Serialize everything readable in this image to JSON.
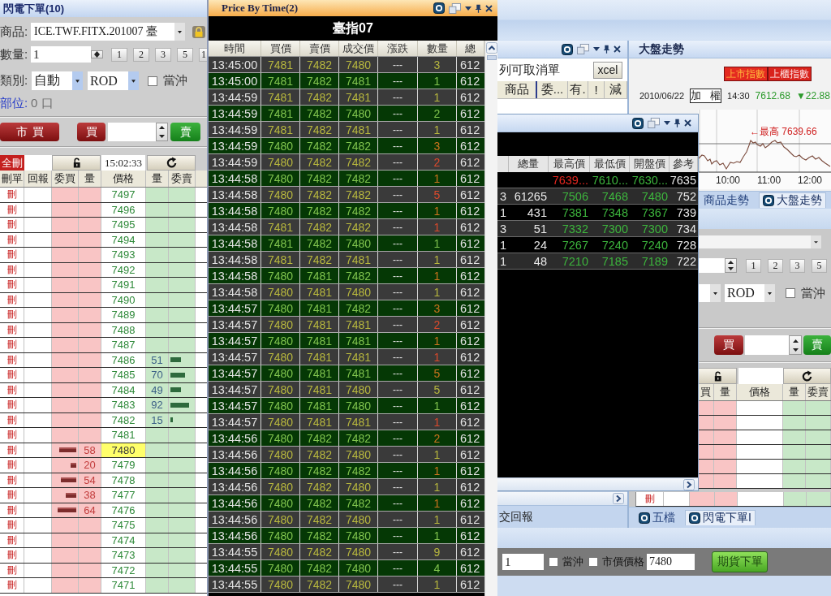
{
  "flash_order": {
    "title": "閃電下單(10)",
    "product": {
      "label": "商品:",
      "value": "ICE.TWF.FITX.201007 臺"
    },
    "quantity": {
      "label": "數量:",
      "value": "1",
      "presets": [
        "1",
        "2",
        "3",
        "5",
        "1"
      ]
    },
    "category": {
      "label": "類別:",
      "type": "自動",
      "condition": "ROD",
      "day_trade": {
        "label": "當沖",
        "checked": false
      }
    },
    "position": {
      "label": "部位:",
      "value": "0 口"
    },
    "actions": {
      "market_buy": "市買",
      "buy": "買",
      "sell": "賣"
    },
    "toolbar": {
      "delete_all": "全刪",
      "time": "15:02:33"
    },
    "ladder": {
      "columns": [
        "刪單",
        "回報",
        "委買",
        "量",
        "價格",
        "量",
        "委賣"
      ],
      "rows": [
        {
          "delete": "刪",
          "price": "7497",
          "current": false
        },
        {
          "delete": "刪",
          "price": "7496",
          "current": false
        },
        {
          "delete": "刪",
          "price": "7495",
          "current": false
        },
        {
          "delete": "刪",
          "price": "7494",
          "current": false
        },
        {
          "delete": "刪",
          "price": "7493",
          "current": false
        },
        {
          "delete": "刪",
          "price": "7492",
          "current": false
        },
        {
          "delete": "刪",
          "price": "7491",
          "current": false
        },
        {
          "delete": "刪",
          "price": "7490",
          "current": false
        },
        {
          "delete": "刪",
          "price": "7489",
          "current": false
        },
        {
          "delete": "刪",
          "price": "7488",
          "current": false
        },
        {
          "delete": "刪",
          "price": "7487",
          "current": false
        },
        {
          "delete": "刪",
          "price": "7486",
          "current": false,
          "ask": {
            "qty": "51",
            "level": 0.45
          }
        },
        {
          "delete": "刪",
          "price": "7485",
          "current": false,
          "ask": {
            "qty": "70",
            "level": 0.66
          }
        },
        {
          "delete": "刪",
          "price": "7484",
          "current": false,
          "ask": {
            "qty": "49",
            "level": 0.45
          }
        },
        {
          "delete": "刪",
          "price": "7483",
          "current": false,
          "ask": {
            "qty": "92",
            "level": 0.83
          }
        },
        {
          "delete": "刪",
          "price": "7482",
          "current": false,
          "ask": {
            "qty": "15",
            "level": 0.1
          }
        },
        {
          "delete": "刪",
          "price": "7481",
          "current": false
        },
        {
          "delete": "刪",
          "price": "7480",
          "current": true,
          "bid": {
            "qty": "58",
            "level": 0.76
          }
        },
        {
          "delete": "刪",
          "price": "7479",
          "current": false,
          "bid": {
            "qty": "20",
            "level": 0.24
          }
        },
        {
          "delete": "刪",
          "price": "7478",
          "current": false,
          "bid": {
            "qty": "54",
            "level": 0.69
          }
        },
        {
          "delete": "刪",
          "price": "7477",
          "current": false,
          "bid": {
            "qty": "38",
            "level": 0.48
          }
        },
        {
          "delete": "刪",
          "price": "7476",
          "current": false,
          "bid": {
            "qty": "64",
            "level": 0.83
          }
        },
        {
          "delete": "刪",
          "price": "7475",
          "current": false
        },
        {
          "delete": "刪",
          "price": "7474",
          "current": false
        },
        {
          "delete": "刪",
          "price": "7473",
          "current": false
        },
        {
          "delete": "刪",
          "price": "7472",
          "current": false
        },
        {
          "delete": "刪",
          "price": "7471",
          "current": false
        }
      ]
    }
  },
  "price_by_time": {
    "title": "Price By Time(2)",
    "symbol": "臺指07",
    "columns": [
      "時間",
      "買價",
      "賣價",
      "成交價",
      "漲跌",
      "數量",
      "總"
    ],
    "rows": [
      {
        "time": "13:45:00",
        "bid": "7481",
        "ask": "7482",
        "price": "7480",
        "change": "---",
        "qty": "3",
        "at_ask": false,
        "total": "612"
      },
      {
        "time": "13:45:00",
        "bid": "7481",
        "ask": "7482",
        "price": "7481",
        "change": "---",
        "qty": "1",
        "at_ask": false,
        "total": "612"
      },
      {
        "time": "13:44:59",
        "bid": "7481",
        "ask": "7482",
        "price": "7481",
        "change": "---",
        "qty": "1",
        "at_ask": false,
        "total": "612"
      },
      {
        "time": "13:44:59",
        "bid": "7481",
        "ask": "7482",
        "price": "7480",
        "change": "---",
        "qty": "2",
        "at_ask": false,
        "total": "612"
      },
      {
        "time": "13:44:59",
        "bid": "7481",
        "ask": "7482",
        "price": "7481",
        "change": "---",
        "qty": "1",
        "at_ask": false,
        "total": "612"
      },
      {
        "time": "13:44:59",
        "bid": "7480",
        "ask": "7482",
        "price": "7482",
        "change": "---",
        "qty": "3",
        "at_ask": true,
        "total": "612"
      },
      {
        "time": "13:44:59",
        "bid": "7480",
        "ask": "7482",
        "price": "7482",
        "change": "---",
        "qty": "2",
        "at_ask": true,
        "total": "612"
      },
      {
        "time": "13:44:58",
        "bid": "7480",
        "ask": "7482",
        "price": "7482",
        "change": "---",
        "qty": "1",
        "at_ask": true,
        "total": "612"
      },
      {
        "time": "13:44:58",
        "bid": "7480",
        "ask": "7482",
        "price": "7482",
        "change": "---",
        "qty": "5",
        "at_ask": true,
        "total": "612"
      },
      {
        "time": "13:44:58",
        "bid": "7480",
        "ask": "7482",
        "price": "7482",
        "change": "---",
        "qty": "1",
        "at_ask": true,
        "total": "612"
      },
      {
        "time": "13:44:58",
        "bid": "7481",
        "ask": "7482",
        "price": "7482",
        "change": "---",
        "qty": "1",
        "at_ask": true,
        "total": "612"
      },
      {
        "time": "13:44:58",
        "bid": "7481",
        "ask": "7482",
        "price": "7480",
        "change": "---",
        "qty": "1",
        "at_ask": false,
        "total": "612"
      },
      {
        "time": "13:44:58",
        "bid": "7481",
        "ask": "7482",
        "price": "7481",
        "change": "---",
        "qty": "1",
        "at_ask": false,
        "total": "612"
      },
      {
        "time": "13:44:58",
        "bid": "7480",
        "ask": "7481",
        "price": "7482",
        "change": "---",
        "qty": "1",
        "at_ask": true,
        "total": "612"
      },
      {
        "time": "13:44:58",
        "bid": "7480",
        "ask": "7481",
        "price": "7480",
        "change": "---",
        "qty": "1",
        "at_ask": false,
        "total": "612"
      },
      {
        "time": "13:44:57",
        "bid": "7480",
        "ask": "7481",
        "price": "7482",
        "change": "---",
        "qty": "3",
        "at_ask": true,
        "total": "612"
      },
      {
        "time": "13:44:57",
        "bid": "7480",
        "ask": "7481",
        "price": "7481",
        "change": "---",
        "qty": "2",
        "at_ask": true,
        "total": "612"
      },
      {
        "time": "13:44:57",
        "bid": "7480",
        "ask": "7481",
        "price": "7481",
        "change": "---",
        "qty": "1",
        "at_ask": true,
        "total": "612"
      },
      {
        "time": "13:44:57",
        "bid": "7480",
        "ask": "7481",
        "price": "7481",
        "change": "---",
        "qty": "1",
        "at_ask": true,
        "total": "612"
      },
      {
        "time": "13:44:57",
        "bid": "7480",
        "ask": "7481",
        "price": "7481",
        "change": "---",
        "qty": "5",
        "at_ask": true,
        "total": "612"
      },
      {
        "time": "13:44:57",
        "bid": "7480",
        "ask": "7481",
        "price": "7480",
        "change": "---",
        "qty": "5",
        "at_ask": false,
        "total": "612"
      },
      {
        "time": "13:44:57",
        "bid": "7480",
        "ask": "7481",
        "price": "7480",
        "change": "---",
        "qty": "1",
        "at_ask": false,
        "total": "612"
      },
      {
        "time": "13:44:57",
        "bid": "7480",
        "ask": "7481",
        "price": "7481",
        "change": "---",
        "qty": "1",
        "at_ask": true,
        "total": "612"
      },
      {
        "time": "13:44:56",
        "bid": "7480",
        "ask": "7482",
        "price": "7482",
        "change": "---",
        "qty": "2",
        "at_ask": true,
        "total": "612"
      },
      {
        "time": "13:44:56",
        "bid": "7480",
        "ask": "7482",
        "price": "7480",
        "change": "---",
        "qty": "1",
        "at_ask": false,
        "total": "612"
      },
      {
        "time": "13:44:56",
        "bid": "7480",
        "ask": "7482",
        "price": "7482",
        "change": "---",
        "qty": "1",
        "at_ask": true,
        "total": "612"
      },
      {
        "time": "13:44:56",
        "bid": "7480",
        "ask": "7482",
        "price": "7480",
        "change": "---",
        "qty": "1",
        "at_ask": false,
        "total": "612"
      },
      {
        "time": "13:44:56",
        "bid": "7480",
        "ask": "7482",
        "price": "7482",
        "change": "---",
        "qty": "1",
        "at_ask": true,
        "total": "612"
      },
      {
        "time": "13:44:56",
        "bid": "7480",
        "ask": "7482",
        "price": "7480",
        "change": "---",
        "qty": "1",
        "at_ask": false,
        "total": "612"
      },
      {
        "time": "13:44:56",
        "bid": "7480",
        "ask": "7482",
        "price": "7480",
        "change": "---",
        "qty": "1",
        "at_ask": false,
        "total": "612"
      },
      {
        "time": "13:44:55",
        "bid": "7480",
        "ask": "7482",
        "price": "7480",
        "change": "---",
        "qty": "9",
        "at_ask": false,
        "total": "612"
      },
      {
        "time": "13:44:55",
        "bid": "7480",
        "ask": "7482",
        "price": "7480",
        "change": "---",
        "qty": "4",
        "at_ask": false,
        "total": "612"
      },
      {
        "time": "13:44:55",
        "bid": "7480",
        "ask": "7482",
        "price": "7480",
        "change": "---",
        "qty": "1",
        "at_ask": false,
        "total": "612"
      }
    ]
  },
  "cancel_panel": {
    "filter": "列可取消單",
    "export_button": "xcel",
    "columns": [
      "商品",
      "委...",
      "有.",
      "!",
      "減"
    ],
    "tab": "交回報"
  },
  "index_chart": {
    "title": "大盤走勢",
    "markets": [
      {
        "label": "上市指數",
        "selected": true
      },
      {
        "label": "上櫃指數",
        "selected": false
      }
    ],
    "date": "2010/06/22",
    "index_name": "加 權",
    "time": "14:30",
    "value": "7612.68",
    "change": "▼22.88",
    "high_label": "←最高 7639.66",
    "x_labels": [
      "10:00",
      "11:00",
      "12:00"
    ],
    "tabs": [
      {
        "label": "商品走勢",
        "selected": false,
        "icon": false
      },
      {
        "label": "大盤走勢",
        "selected": true,
        "icon": true
      }
    ]
  },
  "quote_window": {
    "columns": [
      "總量",
      "最高價",
      "最低價",
      "開盤價",
      "參考"
    ],
    "rows": [
      {
        "high": {
          "text": "7639...",
          "up": true
        },
        "low": {
          "text": "7610...",
          "up": false
        },
        "open": {
          "text": "7630...",
          "up": false
        },
        "ref": "7635"
      },
      {
        "column_1": "3",
        "volume": "61265",
        "high": {
          "text": "7506",
          "up": false
        },
        "low": {
          "text": "7468",
          "up": false
        },
        "open": {
          "text": "7480",
          "up": false
        },
        "ref": "752"
      },
      {
        "column_1": "1",
        "volume": "431",
        "high": {
          "text": "7381",
          "up": false
        },
        "low": {
          "text": "7348",
          "up": false
        },
        "open": {
          "text": "7367",
          "up": false
        },
        "ref": "739"
      },
      {
        "column_1": "3",
        "volume": "51",
        "high": {
          "text": "7332",
          "up": false
        },
        "low": {
          "text": "7300",
          "up": false
        },
        "open": {
          "text": "7300",
          "up": false
        },
        "ref": "734"
      },
      {
        "column_1": "1",
        "volume": "24",
        "high": {
          "text": "7267",
          "up": false
        },
        "low": {
          "text": "7240",
          "up": false
        },
        "open": {
          "text": "7240",
          "up": false
        },
        "ref": "728"
      },
      {
        "column_1": "1",
        "volume": "48",
        "high": {
          "text": "7210",
          "up": false
        },
        "low": {
          "text": "7185",
          "up": false
        },
        "open": {
          "text": "7189",
          "up": false
        },
        "ref": "722"
      }
    ]
  },
  "flash_order_2": {
    "presets": [
      "1",
      "2",
      "3",
      "5"
    ],
    "condition": "ROD",
    "day_trade": {
      "label": "當沖",
      "checked": false
    },
    "actions": {
      "buy": "買",
      "sell": "賣"
    },
    "columns": [
      "買",
      "量",
      "價格",
      "量",
      "委賣"
    ],
    "delete": "刪",
    "tabs": [
      {
        "label": "五檔",
        "selected": false,
        "icon": true
      },
      {
        "label": "閃電下單I",
        "selected": true,
        "icon": true
      }
    ]
  },
  "order_bar": {
    "quantity": "1",
    "day_trade": {
      "label": "當沖",
      "checked": false
    },
    "market_price": {
      "label": "市價價格",
      "checked": false
    },
    "price": "7480",
    "submit": "期貨下單"
  }
}
